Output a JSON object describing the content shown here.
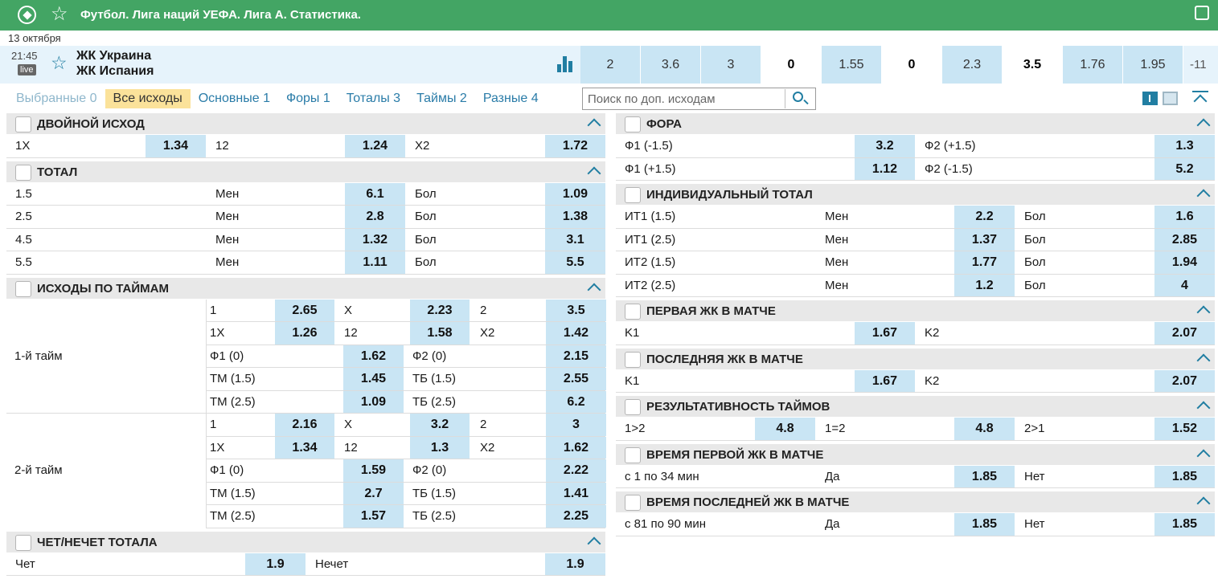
{
  "header": {
    "title": "Футбол. Лига наций УЕФА. Лига А. Статистика."
  },
  "date": "13 октября",
  "match": {
    "time": "21:45",
    "live": "live",
    "team1": "ЖК Украина",
    "team2": "ЖК Испания",
    "odds": [
      "2",
      "3.6",
      "3",
      "0",
      "1.55",
      "0",
      "2.3",
      "3.5",
      "1.76",
      "1.95"
    ],
    "more": "-11"
  },
  "filters": [
    "Выбранные 0",
    "Все исходы",
    "Основные 1",
    "Форы 1",
    "Тоталы 3",
    "Таймы 2",
    "Разные 4"
  ],
  "search": {
    "placeholder": "Поиск по доп. исходам"
  },
  "left": {
    "double": {
      "title": "ДВОЙНОЙ ИСХОД",
      "row": [
        "1X",
        "1.34",
        "12",
        "1.24",
        "X2",
        "1.72"
      ]
    },
    "total": {
      "title": "ТОТАЛ",
      "rows": [
        [
          "1.5",
          "Мен",
          "6.1",
          "Бол",
          "1.09"
        ],
        [
          "2.5",
          "Мен",
          "2.8",
          "Бол",
          "1.38"
        ],
        [
          "4.5",
          "Мен",
          "1.32",
          "Бол",
          "3.1"
        ],
        [
          "5.5",
          "Мен",
          "1.11",
          "Бол",
          "5.5"
        ]
      ]
    },
    "halves": {
      "title": "ИСХОДЫ ПО ТАЙМАМ",
      "h1": {
        "label": "1-й тайм",
        "r3": [
          [
            "1",
            "2.65",
            "X",
            "2.23",
            "2",
            "3.5"
          ],
          [
            "1X",
            "1.26",
            "12",
            "1.58",
            "X2",
            "1.42"
          ]
        ],
        "r2": [
          [
            "Ф1 (0)",
            "1.62",
            "Ф2 (0)",
            "2.15"
          ],
          [
            "ТМ (1.5)",
            "1.45",
            "ТБ (1.5)",
            "2.55"
          ],
          [
            "ТМ (2.5)",
            "1.09",
            "ТБ (2.5)",
            "6.2"
          ]
        ]
      },
      "h2": {
        "label": "2-й тайм",
        "r3": [
          [
            "1",
            "2.16",
            "X",
            "3.2",
            "2",
            "3"
          ],
          [
            "1X",
            "1.34",
            "12",
            "1.3",
            "X2",
            "1.62"
          ]
        ],
        "r2": [
          [
            "Ф1 (0)",
            "1.59",
            "Ф2 (0)",
            "2.22"
          ],
          [
            "ТМ (1.5)",
            "2.7",
            "ТБ (1.5)",
            "1.41"
          ],
          [
            "ТМ (2.5)",
            "1.57",
            "ТБ (2.5)",
            "2.25"
          ]
        ]
      }
    },
    "oddeven": {
      "title": "ЧЕТ/НЕЧЕТ ТОТАЛА",
      "row": [
        "Чет",
        "1.9",
        "Нечет",
        "1.9"
      ]
    }
  },
  "right": {
    "fora": {
      "title": "ФОРА",
      "rows": [
        [
          "Ф1 (-1.5)",
          "3.2",
          "Ф2 (+1.5)",
          "1.3"
        ],
        [
          "Ф1 (+1.5)",
          "1.12",
          "Ф2 (-1.5)",
          "5.2"
        ]
      ]
    },
    "ind": {
      "title": "ИНДИВИДУАЛЬНЫЙ ТОТАЛ",
      "rows": [
        [
          "ИТ1 (1.5)",
          "Мен",
          "2.2",
          "Бол",
          "1.6"
        ],
        [
          "ИТ1 (2.5)",
          "Мен",
          "1.37",
          "Бол",
          "2.85"
        ],
        [
          "ИТ2 (1.5)",
          "Мен",
          "1.77",
          "Бол",
          "1.94"
        ],
        [
          "ИТ2 (2.5)",
          "Мен",
          "1.2",
          "Бол",
          "4"
        ]
      ]
    },
    "first": {
      "title": "ПЕРВАЯ ЖК В МАТЧЕ",
      "row": [
        "K1",
        "1.67",
        "K2",
        "2.07"
      ]
    },
    "last": {
      "title": "ПОСЛЕДНЯЯ ЖК В МАТЧЕ",
      "row": [
        "K1",
        "1.67",
        "K2",
        "2.07"
      ]
    },
    "perf": {
      "title": "РЕЗУЛЬТАТИВНОСТЬ ТАЙМОВ",
      "row": [
        "1>2",
        "4.8",
        "1=2",
        "4.8",
        "2>1",
        "1.52"
      ]
    },
    "tfirst": {
      "title": "ВРЕМЯ ПЕРВОЙ ЖК В МАТЧЕ",
      "row": [
        "с 1 по 34 мин",
        "Да",
        "1.85",
        "Нет",
        "1.85"
      ]
    },
    "tlast": {
      "title": "ВРЕМЯ ПОСЛЕДНЕЙ ЖК В МАТЧЕ",
      "row": [
        "с 81 по 90 мин",
        "Да",
        "1.85",
        "Нет",
        "1.85"
      ]
    }
  }
}
